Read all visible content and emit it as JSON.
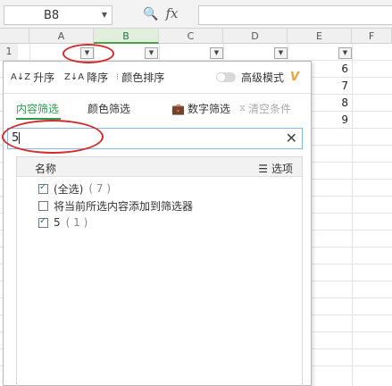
{
  "name_box": {
    "value": "B8"
  },
  "formula_bar": {
    "fx_label": "fx"
  },
  "columns": [
    "A",
    "B",
    "C",
    "D",
    "E",
    "F"
  ],
  "row_numbers": [
    "1"
  ],
  "column_e_values": [
    "6",
    "7",
    "8",
    "9"
  ],
  "toolbar": {
    "sort_asc": "升序",
    "sort_desc": "降序",
    "color_sort": "颜色排序",
    "advanced_mode": "高级模式"
  },
  "tabs": {
    "content_filter": "内容筛选",
    "color_filter": "颜色筛选",
    "number_filter": "数字筛选",
    "clear_conditions": "清空条件"
  },
  "search": {
    "value": "5"
  },
  "list": {
    "header_name": "名称",
    "header_options": "选项",
    "items": [
      {
        "label": "(全选)",
        "count": "( 7 )",
        "checked": true
      },
      {
        "label": "将当前所选内容添加到筛选器",
        "count": "",
        "checked": false
      },
      {
        "label": "5",
        "count": "( 1 )",
        "checked": true
      }
    ]
  },
  "colors": {
    "accent_green": "#2e9a4e",
    "annotation_red": "#d42a2a"
  }
}
